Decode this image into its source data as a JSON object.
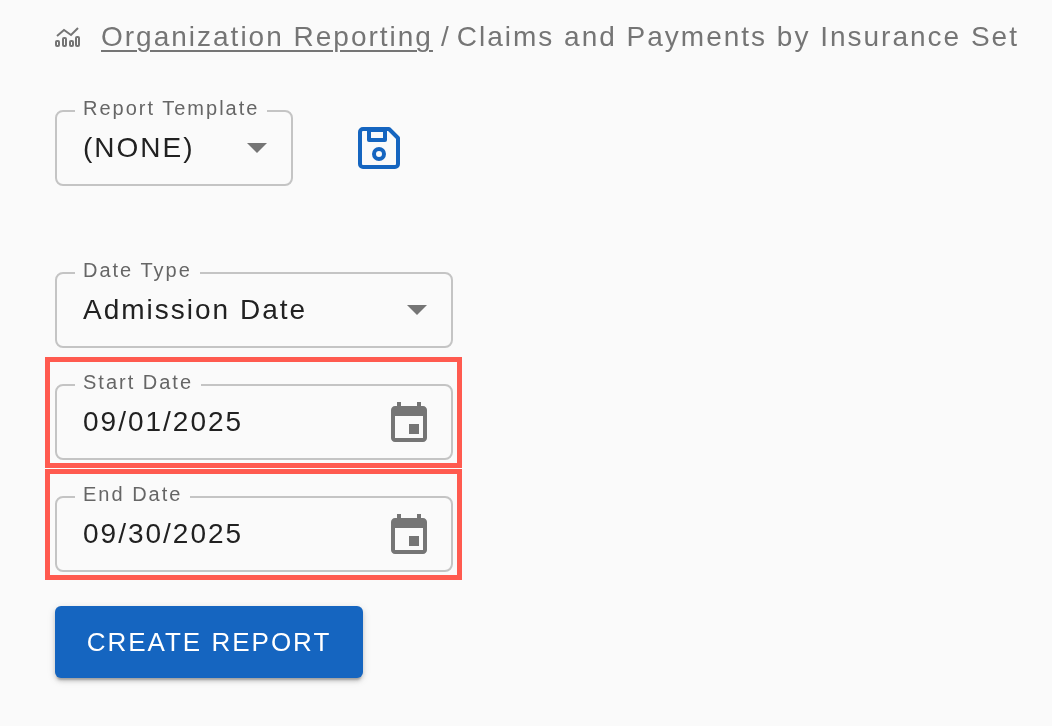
{
  "breadcrumb": {
    "link": "Organization Reporting",
    "separator": "/",
    "current": "Claims and Payments by Insurance Set"
  },
  "template": {
    "label": "Report Template",
    "value": "(NONE)"
  },
  "fields": [
    {
      "kind": "select",
      "label": "Date Type",
      "value": "Admission Date",
      "highlighted": false
    },
    {
      "kind": "date",
      "label": "Start Date",
      "value": "09/01/2025",
      "highlighted": true
    },
    {
      "kind": "date",
      "label": "End Date",
      "value": "09/30/2025",
      "highlighted": true
    }
  ],
  "create_button": "CREATE REPORT"
}
